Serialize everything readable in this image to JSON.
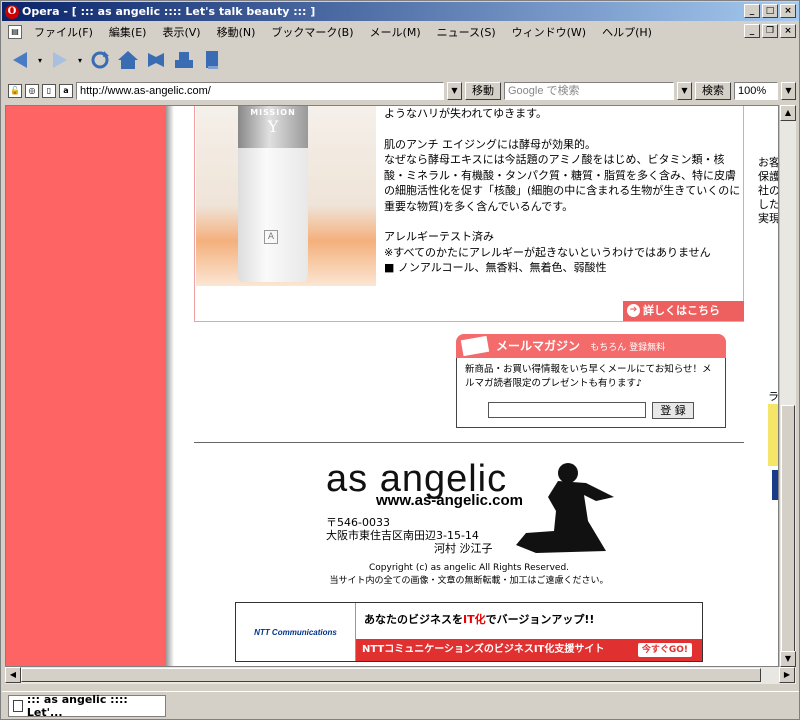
{
  "window": {
    "title": "Opera - [ ::: as angelic :::: Let's talk beauty ::: ]"
  },
  "menu": {
    "items": [
      "ファイル(F)",
      "編集(E)",
      "表示(V)",
      "移動(N)",
      "ブックマーク(B)",
      "メール(M)",
      "ニュース(S)",
      "ウィンドウ(W)",
      "ヘルプ(H)"
    ]
  },
  "address": {
    "url": "http://www.as-angelic.com/",
    "go_label": "移動",
    "search_placeholder": "Google で検索",
    "search_label": "検索",
    "zoom": "100%"
  },
  "page": {
    "product_label_top": "MISSION",
    "product_letter": "Y",
    "paragraph0": "ようなハリが失われてゆきます。",
    "paragraph1": "肌のアンチ エイジングには酵母が効果的。",
    "paragraph2": "なぜなら酵母エキスには今話題のアミノ酸をはじめ、ビタミン類・核酸・ミネラル・有機酸・タンパク質・糖質・脂質を多く含み、特に皮膚の細胞活性化を促す「核酸」(細胞の中に含まれる生物が生きていくのに重要な物質)を多く含んでいるんです。",
    "paragraph3": "アレルギーテスト済み",
    "paragraph4": "※すべてのかたにアレルギーが起きないというわけではありません",
    "paragraph5": "■ ノンアルコール、無香料、無着色、弱酸性",
    "detail_button": "詳しくはこちら",
    "mail_title": "メールマガジン",
    "mail_sub": "もちろん 登録無料",
    "mail_text": "新商品・お買い得情報をいち早くメールにてお知らせ！メルマガ読者限定のプレゼントも有ります♪",
    "mail_button": "登 録",
    "logo": "as angelic",
    "logo_url": "www.as-angelic.com",
    "postal": "〒546-0033",
    "address_line": "大阪市東住吉区南田辺3-15-14",
    "owner": "河村 沙江子",
    "copyright": "Copyright (c) as angelic All Rights Reserved.",
    "notice": "当サイト内の全ての画像・文章の無断転載・加工はご遠慮ください。",
    "banner_logo": "NTT Communications",
    "banner_text_a": "あなたのビジネスを",
    "banner_text_em": "IT化",
    "banner_text_b": "でバージョンアップ!!",
    "banner_red": "NTTコミュニケーションズのビジネスIT化支援サイト",
    "banner_go": "今すぐGO!",
    "right_edge": [
      "お客",
      "保護",
      "社の",
      "した",
      "実現"
    ],
    "right_edge_b": "ラ"
  },
  "status": {
    "tab_label": "::: as angelic :::: Let'..."
  }
}
